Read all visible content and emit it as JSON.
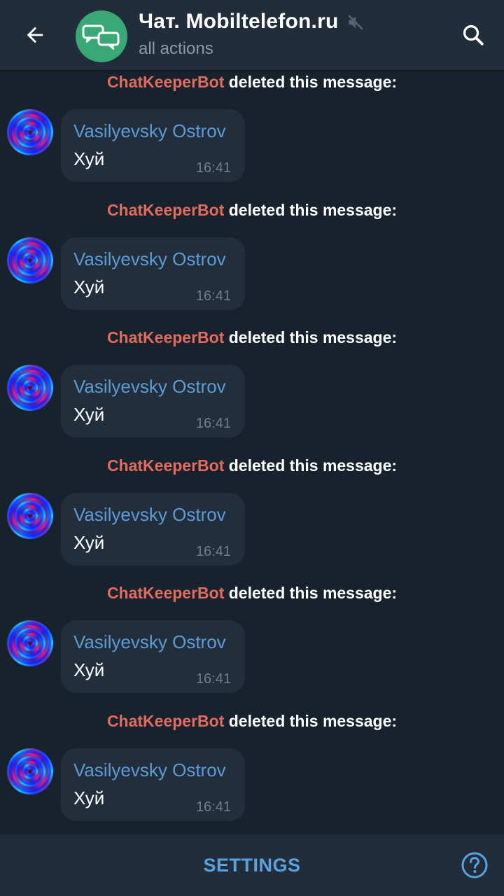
{
  "header": {
    "title": "Чат. Mobiltelefon.ru",
    "subtitle": "all actions",
    "back_icon": "arrow-left-icon",
    "mute_icon": "muted-speaker-icon",
    "search_icon": "search-icon"
  },
  "messages": [
    {
      "actor": "ChatKeeperBot",
      "action": "deleted this message:",
      "sender": "Vasilyevsky Ostrov",
      "text": "Хуй",
      "time": "16:41"
    },
    {
      "actor": "ChatKeeperBot",
      "action": "deleted this message:",
      "sender": "Vasilyevsky Ostrov",
      "text": "Хуй",
      "time": "16:41"
    },
    {
      "actor": "ChatKeeperBot",
      "action": "deleted this message:",
      "sender": "Vasilyevsky Ostrov",
      "text": "Хуй",
      "time": "16:41"
    },
    {
      "actor": "ChatKeeperBot",
      "action": "deleted this message:",
      "sender": "Vasilyevsky Ostrov",
      "text": "Хуй",
      "time": "16:41"
    },
    {
      "actor": "ChatKeeperBot",
      "action": "deleted this message:",
      "sender": "Vasilyevsky Ostrov",
      "text": "Хуй",
      "time": "16:41"
    },
    {
      "actor": "ChatKeeperBot",
      "action": "deleted this message:",
      "sender": "Vasilyevsky Ostrov",
      "text": "Хуй",
      "time": "16:41"
    }
  ],
  "footer": {
    "settings_label": "SETTINGS",
    "help_icon": "question-circle-icon"
  },
  "colors": {
    "background": "#18222d",
    "header": "#212d3b",
    "bubble": "#222e3b",
    "actor": "#e26b60",
    "sender": "#5c9bd6",
    "accent": "#5aa2dc",
    "chat_avatar": "#3aa776"
  }
}
